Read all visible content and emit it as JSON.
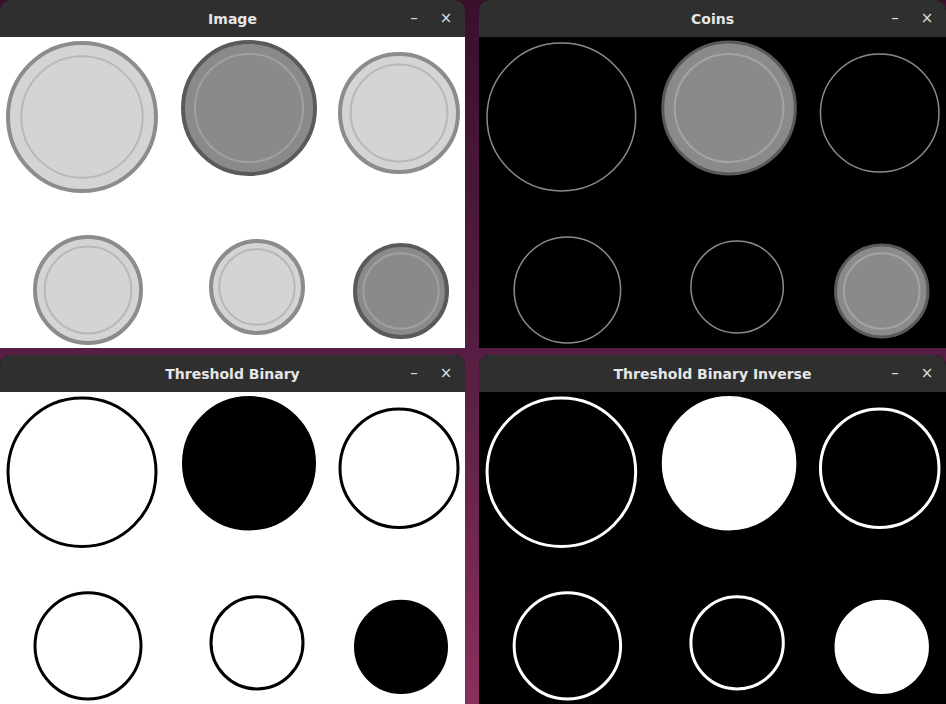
{
  "windows": [
    {
      "title": "Image",
      "kind": "grayscale"
    },
    {
      "title": "Coins",
      "kind": "masked"
    },
    {
      "title": "Threshold Binary",
      "kind": "binary"
    },
    {
      "title": "Threshold Binary Inverse",
      "kind": "inverse"
    }
  ],
  "controls": {
    "minimize": "–",
    "close": "×"
  }
}
